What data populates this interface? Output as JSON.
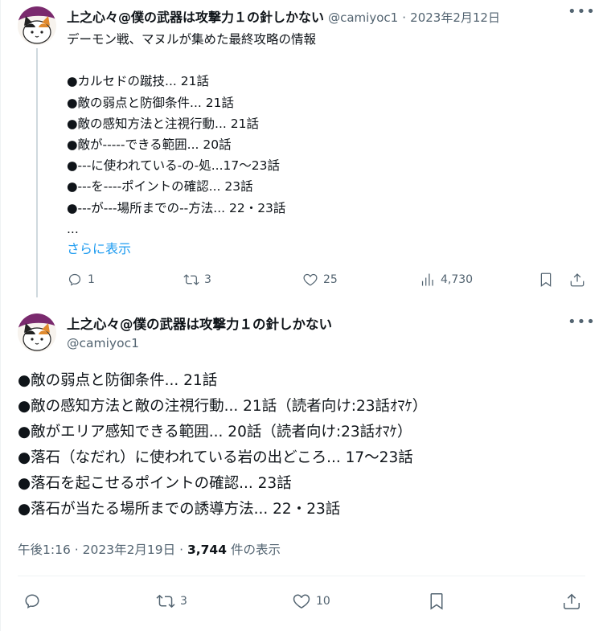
{
  "tweet1": {
    "name": "上之心々@僕の武器は攻撃力１の針しかない",
    "handle": "@camiyoc1",
    "separator": "·",
    "date": "2023年2月12日",
    "intro": "デーモン戦、マヌルが集めた最終攻略の情報",
    "lines": [
      "●カルセドの蹴技... 21話",
      "●敵の弱点と防御条件... 21話",
      "●敵の感知方法と注視行動...  21話",
      "●敵が-----できる範囲... 20話",
      "●---に使われている-の-処...17～23話",
      "●---を----ポイントの確認... 23話",
      "●---が---場所までの--方法... 22・23話",
      "..."
    ],
    "show_more": "さらに表示",
    "replies": "1",
    "retweets": "3",
    "likes": "25",
    "views": "4,730"
  },
  "tweet2": {
    "name": "上之心々@僕の武器は攻撃力１の針しかない",
    "handle": "@camiyoc1",
    "lines": [
      "●敵の弱点と防御条件... 21話",
      "●敵の感知方法と敵の注視行動...  21話（読者向け:23話ｵﾏｹ）",
      "●敵がエリア感知できる範囲... 20話（読者向け:23話ｵﾏｹ）",
      "●落石（なだれ）に使われている岩の出どころ... 17～23話",
      "●落石を起こせるポイントの確認... 23話",
      "●落石が当たる場所までの誘導方法... 22・23話"
    ],
    "time": "午後1:16",
    "date": "2023年2月19日",
    "sep": "·",
    "views_count": "3,744",
    "views_label": "件の表示",
    "retweets": "3",
    "likes": "10"
  },
  "icons": {
    "reply": "reply-icon",
    "retweet": "retweet-icon",
    "like": "heart-icon",
    "views": "views-icon",
    "bookmark": "bookmark-icon",
    "share": "share-icon",
    "more": "more-icon"
  },
  "colors": {
    "link": "#1d9bf0",
    "secondary_text": "#536471",
    "primary_text": "#0f1419",
    "thread_line": "#cfd9de"
  }
}
